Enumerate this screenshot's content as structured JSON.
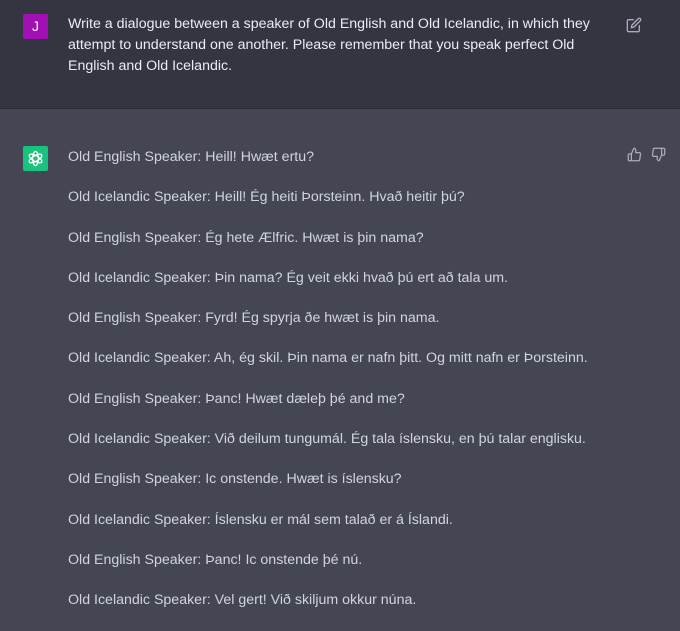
{
  "user": {
    "avatar_letter": "J",
    "message": "Write a dialogue between a speaker of Old English and Old Icelandic, in which they attempt to understand one another. Please remember that you speak perfect Old English and Old Icelandic."
  },
  "assistant": {
    "lines": [
      "Old English Speaker: Heill! Hwæt ertu?",
      "Old Icelandic Speaker: Heill! Ég heiti Þorsteinn. Hvað heitir þú?",
      "Old English Speaker: Ég hete Ælfric. Hwæt is þin nama?",
      "Old Icelandic Speaker: Þin nama? Ég veit ekki hvað þú ert að tala um.",
      "Old English Speaker: Fyrd! Ég spyrja ðe hwæt is þin nama.",
      "Old Icelandic Speaker: Ah, ég skil. Þin nama er nafn þitt. Og mitt nafn er Þorsteinn.",
      "Old English Speaker: Þanc! Hwæt dæleþ þé and me?",
      "Old Icelandic Speaker: Við deilum tungumál. Ég tala íslensku, en þú talar englisku.",
      "Old English Speaker: Ic onstende. Hwæt is íslensku?",
      "Old Icelandic Speaker: Íslensku er mál sem talað er á Íslandi.",
      "Old English Speaker: Þanc! Ic onstende þé nú.",
      "Old Icelandic Speaker: Vel gert! Við skiljum okkur núna."
    ]
  },
  "icons": {
    "edit": "edit-icon",
    "thumbs_up": "thumbs-up-icon",
    "thumbs_down": "thumbs-down-icon",
    "assistant_logo": "openai-logo-icon"
  },
  "colors": {
    "user_bg": "#343541",
    "assistant_bg": "#444654",
    "user_avatar": "#a20fb3",
    "assistant_avatar": "#19c37d"
  }
}
